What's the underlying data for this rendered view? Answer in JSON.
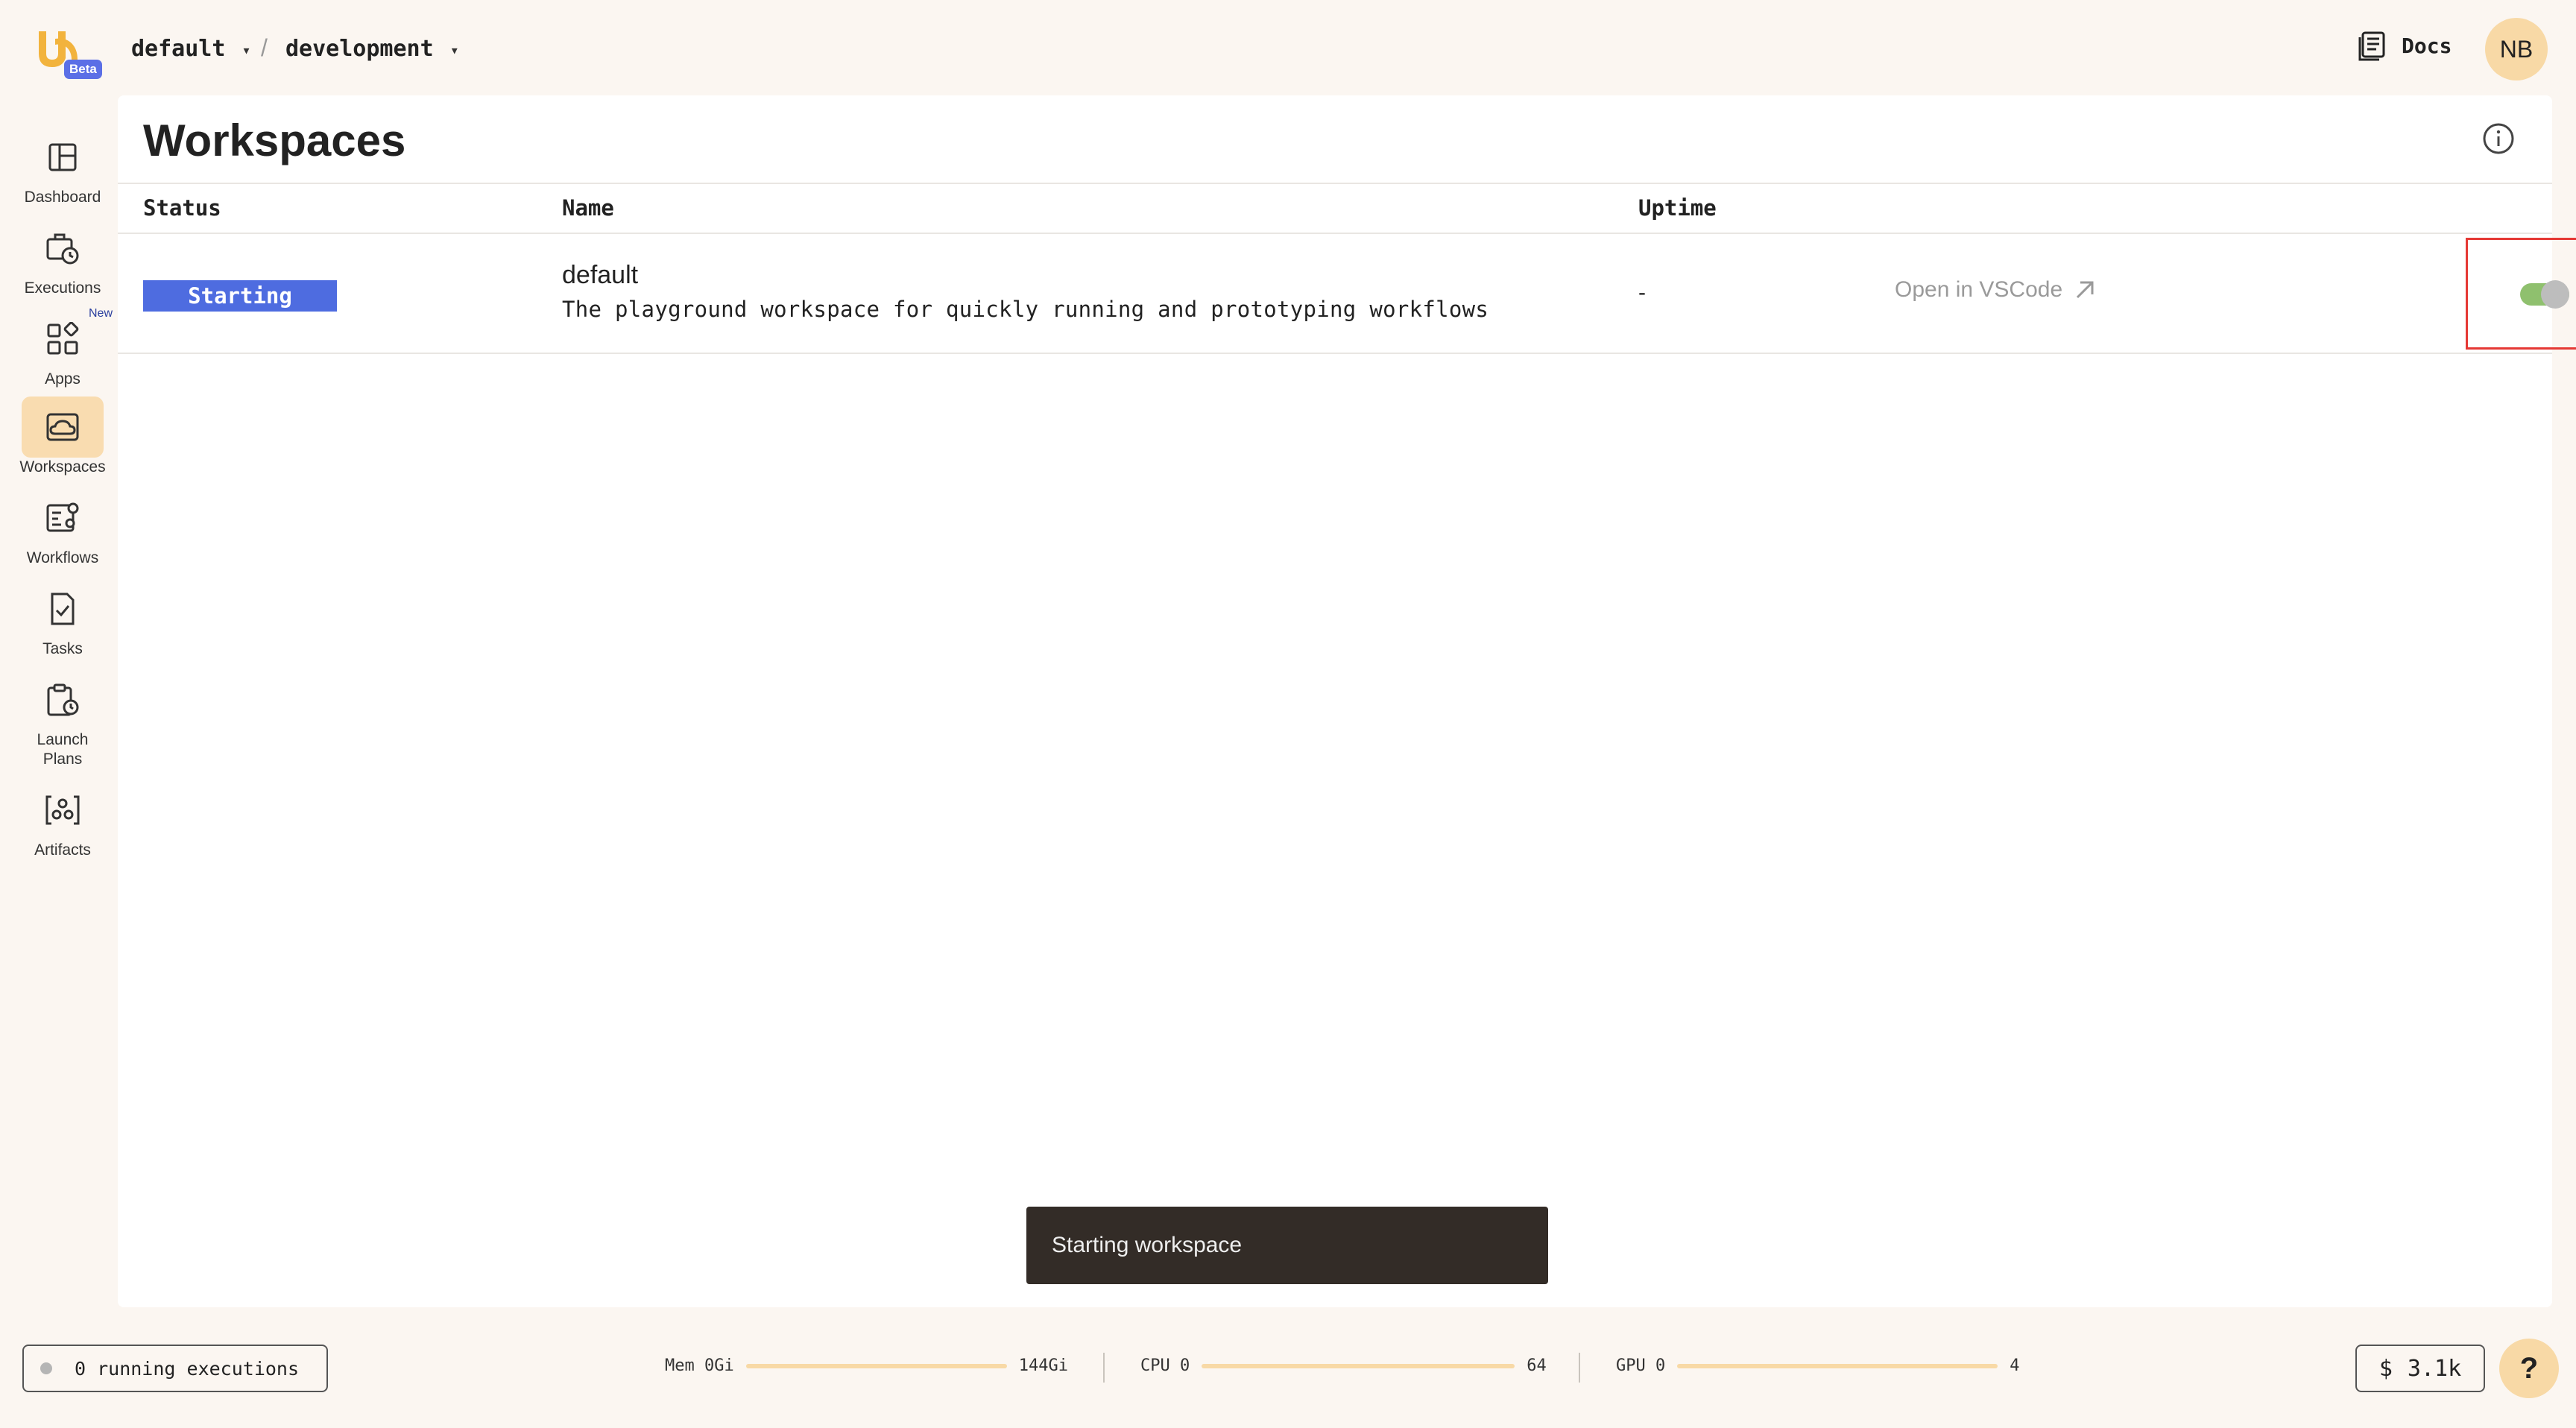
{
  "header": {
    "beta_label": "Beta",
    "project": "default",
    "separator": "/",
    "domain": "development",
    "docs_label": "Docs",
    "avatar_initials": "NB"
  },
  "sidebar": {
    "items": [
      {
        "label": "Dashboard",
        "icon": "dashboard-icon"
      },
      {
        "label": "Executions",
        "icon": "executions-icon"
      },
      {
        "label": "Apps",
        "icon": "apps-icon",
        "badge": "New"
      },
      {
        "label": "Workspaces",
        "icon": "workspaces-icon",
        "active": true
      },
      {
        "label": "Workflows",
        "icon": "workflows-icon"
      },
      {
        "label": "Tasks",
        "icon": "tasks-icon"
      },
      {
        "label": "Launch Plans",
        "icon": "launch-plans-icon"
      },
      {
        "label": "Artifacts",
        "icon": "artifacts-icon"
      }
    ]
  },
  "main": {
    "title": "Workspaces",
    "columns": [
      "Status",
      "Name",
      "Uptime"
    ],
    "rows": [
      {
        "status": "Starting",
        "name": "default",
        "description": "The playground workspace for quickly running and prototyping workflows",
        "uptime": "-",
        "open_label": "Open in VSCode",
        "toggle_on": true
      }
    ]
  },
  "toast": {
    "message": "Starting workspace"
  },
  "footer": {
    "running": "0 running executions",
    "mem": {
      "label": "Mem",
      "min": "0Gi",
      "max": "144Gi"
    },
    "cpu": {
      "label": "CPU",
      "min": "0",
      "max": "64"
    },
    "gpu": {
      "label": "GPU",
      "min": "0",
      "max": "4"
    },
    "cost_symbol": "$",
    "cost_value": "3.1k",
    "help_label": "?"
  },
  "colors": {
    "accent": "#f8d9a6",
    "status_badge": "#4e6ce0",
    "toggle_track": "#8fc06e",
    "highlight_box": "#e53935"
  }
}
